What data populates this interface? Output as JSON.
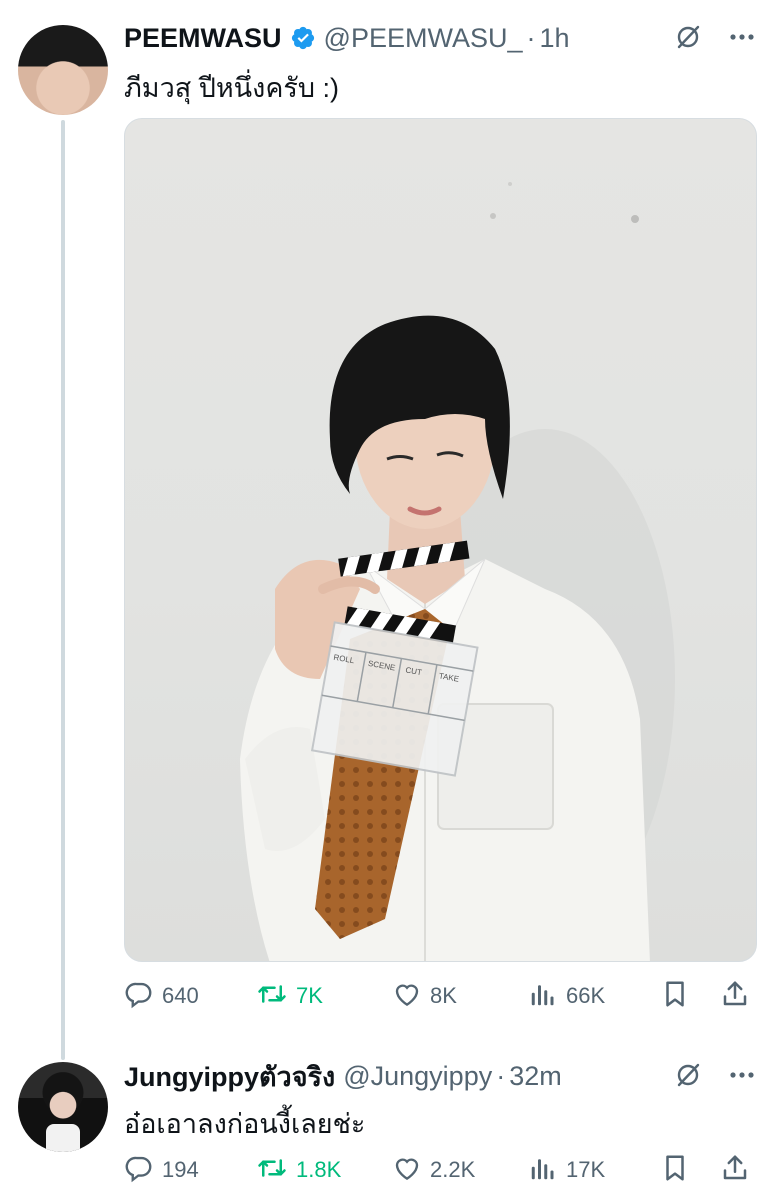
{
  "tweets": [
    {
      "display_name": "PEEMWASU",
      "handle": "@PEEMWASU_",
      "separator": "·",
      "time": "1h",
      "text": "ภีมวสุ ปีหนึ่งครับ :)",
      "verified": true,
      "media": {
        "clapperboard_labels": [
          "ROLL",
          "SCENE",
          "CUT",
          "TAKE"
        ]
      },
      "stats": {
        "replies": "640",
        "retweets": "7K",
        "likes": "8K",
        "views": "66K"
      }
    },
    {
      "display_name": "Jungyippyตัวจริง",
      "handle": "@Jungyippy",
      "separator": "·",
      "time": "32m",
      "text": "อ๋อเอาลงก่อนงี้เลยช่ะ",
      "verified": false,
      "stats": {
        "replies": "194",
        "retweets": "1.8K",
        "likes": "2.2K",
        "views": "17K"
      }
    }
  ],
  "icons": {
    "verified": "verified-badge-icon",
    "grok": "grok-icon",
    "more": "more-icon",
    "reply": "reply-icon",
    "retweet": "retweet-icon",
    "like": "like-icon",
    "views": "views-icon",
    "bookmark": "bookmark-icon",
    "share": "share-icon"
  },
  "colors": {
    "text": "#0f1419",
    "secondary": "#536471",
    "verified": "#1d9bf0",
    "retweet_active": "#00ba7c",
    "thread_line": "#cfd9de"
  }
}
